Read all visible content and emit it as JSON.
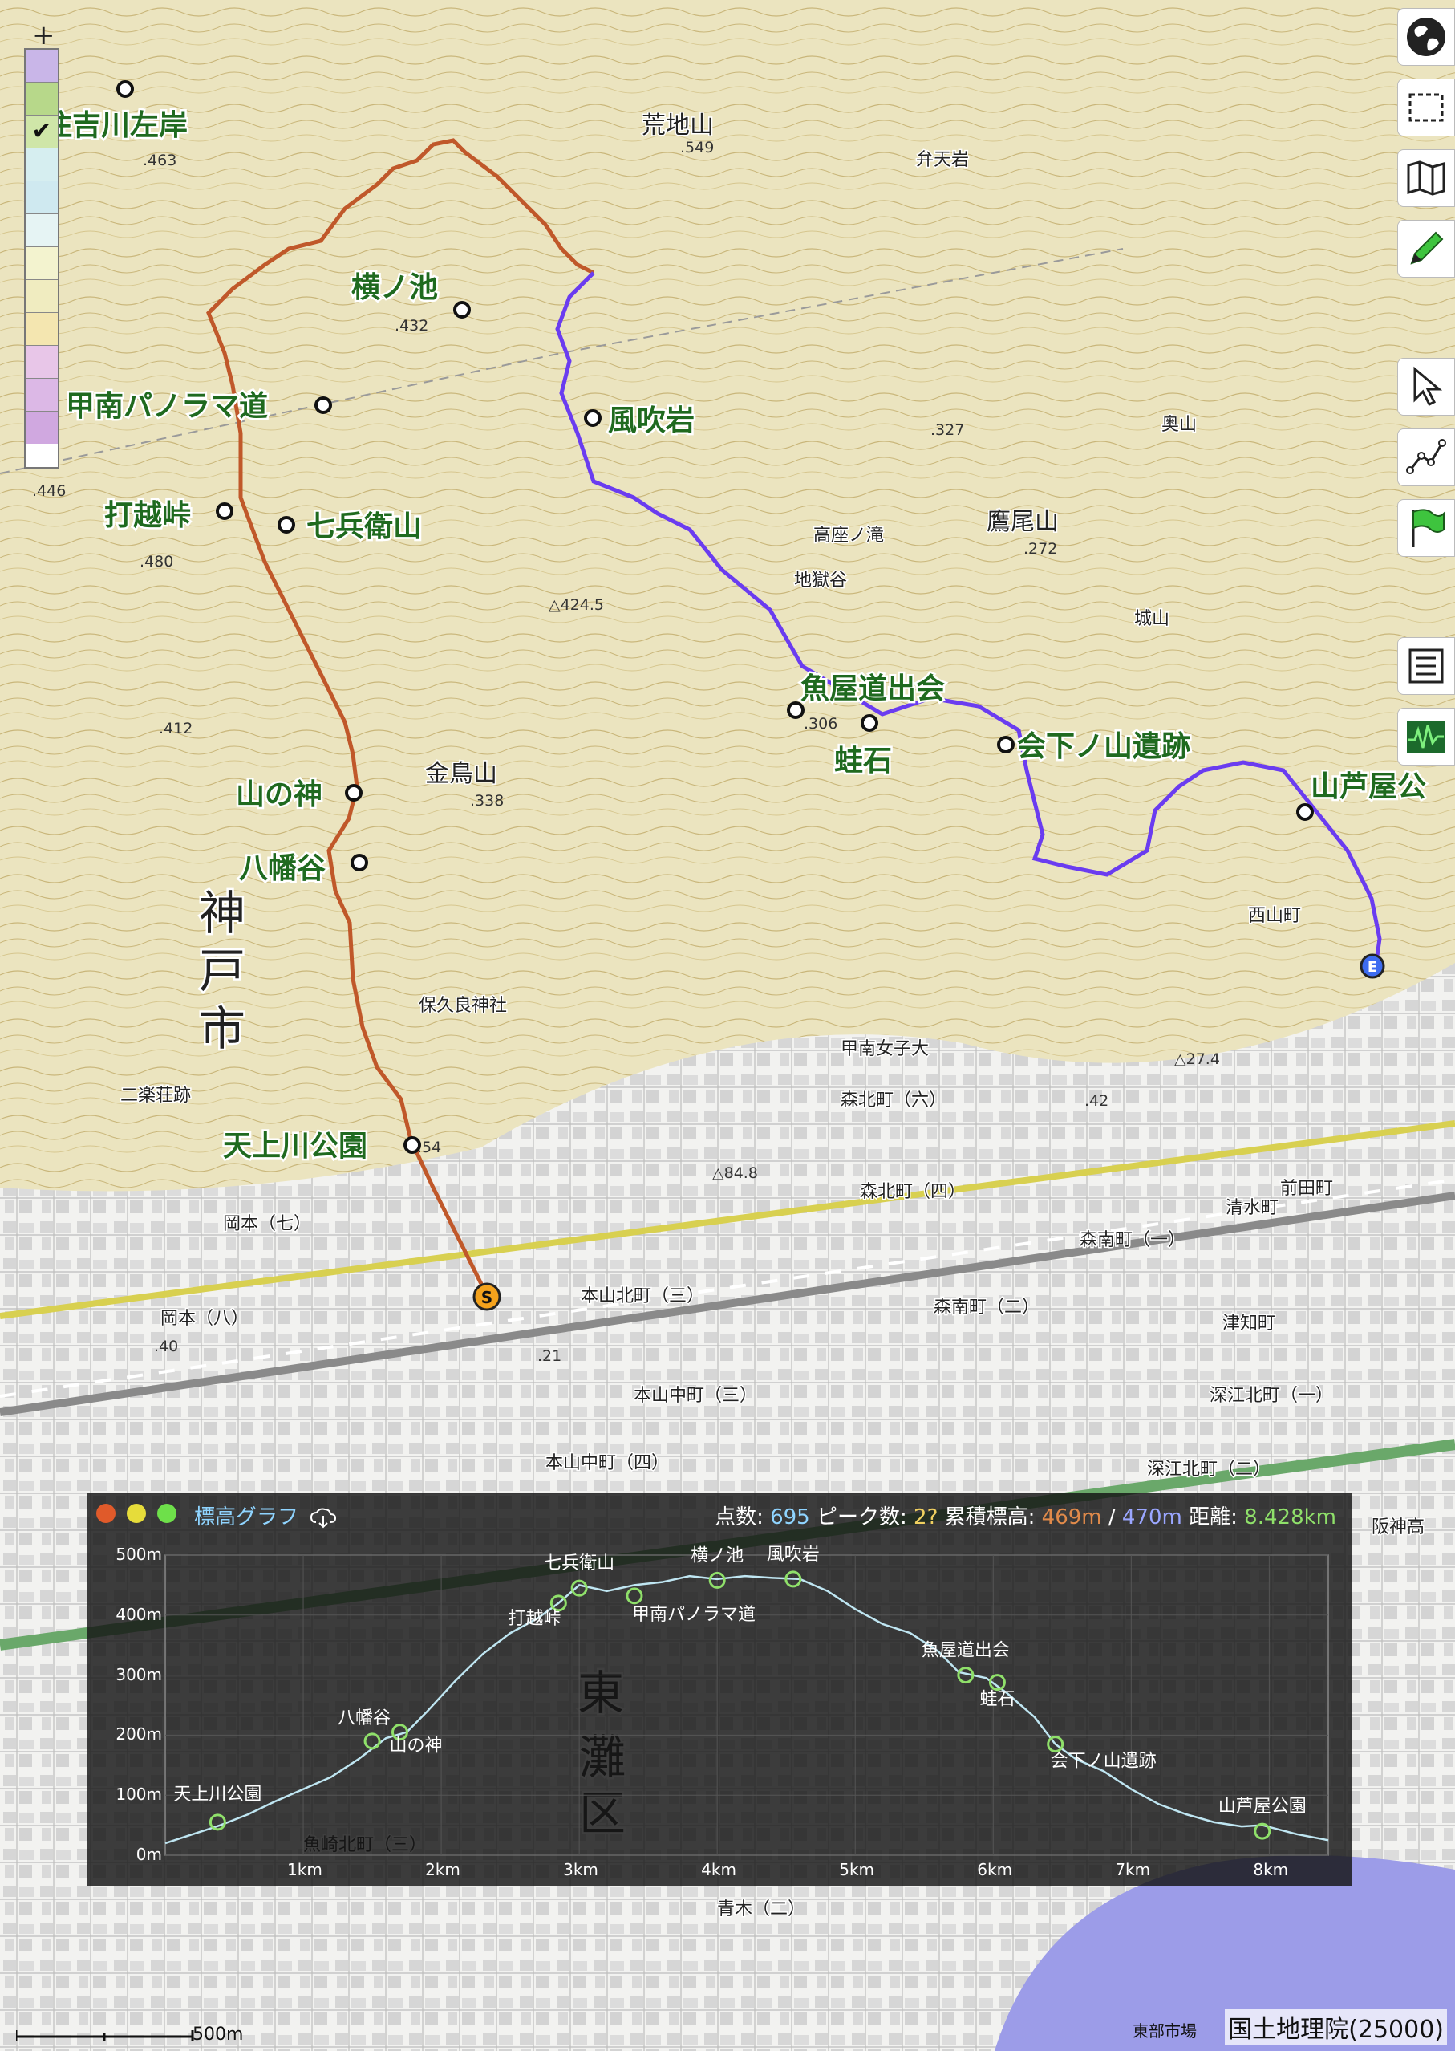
{
  "map": {
    "place_labels": [
      {
        "text": "住吉川左岸",
        "cls": "wp"
      },
      {
        "text": "荒地山",
        "cls": "mtn"
      },
      {
        "text": "弁天岩",
        "cls": "small"
      },
      {
        "text": "横ノ池",
        "cls": "wp"
      },
      {
        "text": "甲南パノラマ道",
        "cls": "wp"
      },
      {
        "text": "風吹岩",
        "cls": "wp"
      },
      {
        "text": "打越峠",
        "cls": "wp"
      },
      {
        "text": "七兵衛山",
        "cls": "wp"
      },
      {
        "text": "奥山",
        "cls": "small"
      },
      {
        "text": "鷹尾山",
        "cls": "mtn"
      },
      {
        "text": "高座ノ滝",
        "cls": "small"
      },
      {
        "text": "地獄谷",
        "cls": "small"
      },
      {
        "text": "城山",
        "cls": "small"
      },
      {
        "text": "魚屋道出会",
        "cls": "wp"
      },
      {
        "text": "蛙石",
        "cls": "wp"
      },
      {
        "text": "会下ノ山遺跡",
        "cls": "wp"
      },
      {
        "text": "山芦屋公",
        "cls": "wp"
      },
      {
        "text": "金鳥山",
        "cls": "mtn"
      },
      {
        "text": "山の神",
        "cls": "wp"
      },
      {
        "text": "八幡谷",
        "cls": "wp"
      },
      {
        "text": "神",
        "cls": "city"
      },
      {
        "text": "戸",
        "cls": "city"
      },
      {
        "text": "市",
        "cls": "city"
      },
      {
        "text": "保久良神社",
        "cls": "small"
      },
      {
        "text": "二楽荘跡",
        "cls": "small"
      },
      {
        "text": "天上川公園",
        "cls": "wp"
      },
      {
        "text": "甲南女子大",
        "cls": "small"
      },
      {
        "text": "森北町（六）",
        "cls": "small"
      },
      {
        "text": "森北町（四）",
        "cls": "small"
      },
      {
        "text": "岡本（七）",
        "cls": "small"
      },
      {
        "text": "本山北町（三）",
        "cls": "small"
      },
      {
        "text": "森南町（二）",
        "cls": "small"
      },
      {
        "text": "森南町（一）",
        "cls": "small"
      },
      {
        "text": "清水町",
        "cls": "small"
      },
      {
        "text": "前田町",
        "cls": "small"
      },
      {
        "text": "津知町",
        "cls": "small"
      },
      {
        "text": "本山中町（三）",
        "cls": "small"
      },
      {
        "text": "深江北町（一）",
        "cls": "small"
      },
      {
        "text": "本山中町（四）",
        "cls": "small"
      },
      {
        "text": "深江北町（二）",
        "cls": "small"
      },
      {
        "text": "岡本（八）",
        "cls": "small"
      },
      {
        "text": "西山町",
        "cls": "small"
      },
      {
        "text": "魚崎北町（三）",
        "cls": "small"
      },
      {
        "text": "青木（二）",
        "cls": "small"
      },
      {
        "text": "東",
        "cls": "ward"
      },
      {
        "text": "灘",
        "cls": "ward"
      },
      {
        "text": "区",
        "cls": "ward"
      },
      {
        "text": "阪神高",
        "cls": "small"
      }
    ],
    "elevations": [
      ".463",
      ".549",
      ".432",
      ".327",
      ".272",
      ".480",
      ".412",
      ".338",
      "△424.5",
      ".306",
      ".54",
      "△84.8",
      "△27.4",
      ".42",
      ".21",
      ".40",
      ".446"
    ],
    "markers": {
      "start": "S",
      "end": "E"
    },
    "scale_label": "500m",
    "credit": "国土地理院(25000)",
    "credit_small": "東部市場"
  },
  "toolbar": {
    "icons": [
      "globe-icon",
      "select-rectangle-icon",
      "map-icon",
      "pencil-icon",
      "pointer-icon",
      "polyline-icon",
      "flag-icon",
      "list-icon",
      "elevation-graph-icon"
    ]
  },
  "legend": {
    "zoom_label": "+"
  },
  "colors": {
    "route_ascent": "#c0582a",
    "route_descent": "#6a3cf0",
    "waypoint_label": "#1f6a1f",
    "graph_bg": "#141414",
    "graph_line": "#bfe6f2",
    "graph_marker": "#8fe06a",
    "stat_ascent": "#e08a4a",
    "stat_descent": "#9aa6ff",
    "stat_distance": "#8fe06a",
    "stat_points": "#8fd4ff",
    "stat_peaks": "#f0d060"
  },
  "elevation_graph": {
    "title": "標高グラフ",
    "stats": {
      "points_label": "点数:",
      "points_value": "695",
      "peaks_label": "ピーク数:",
      "peaks_value": "2?",
      "gain_label": "累積標高:",
      "gain_up": "469m",
      "slash": "/",
      "gain_down": "470m",
      "distance_label": "距離:",
      "distance_value": "8.428km"
    }
  },
  "chart_data": {
    "type": "line",
    "title": "標高グラフ",
    "xlabel": "",
    "ylabel": "",
    "xlim": [
      0,
      8.428
    ],
    "ylim": [
      0,
      500
    ],
    "y_ticks": [
      "0m",
      "100m",
      "200m",
      "300m",
      "400m",
      "500m"
    ],
    "x_ticks": [
      "1km",
      "2km",
      "3km",
      "4km",
      "5km",
      "6km",
      "7km",
      "8km"
    ],
    "grid": true,
    "series": [
      {
        "x": [
          0,
          0.2,
          0.4,
          0.6,
          0.8,
          1.0,
          1.2,
          1.4,
          1.6,
          1.75,
          1.9,
          2.1,
          2.3,
          2.5,
          2.7,
          2.85,
          3.0,
          3.2,
          3.4,
          3.6,
          3.8,
          4.0,
          4.2,
          4.4,
          4.6,
          4.8,
          5.0,
          5.2,
          5.4,
          5.6,
          5.75,
          5.95,
          6.1,
          6.3,
          6.45,
          6.6,
          6.8,
          7.0,
          7.2,
          7.4,
          7.6,
          7.8,
          7.95,
          8.2,
          8.428
        ],
        "y": [
          20,
          35,
          50,
          68,
          90,
          110,
          130,
          160,
          195,
          205,
          240,
          290,
          335,
          370,
          395,
          420,
          450,
          440,
          450,
          455,
          465,
          460,
          465,
          462,
          460,
          440,
          410,
          385,
          370,
          340,
          305,
          295,
          270,
          230,
          185,
          160,
          140,
          110,
          85,
          68,
          55,
          48,
          50,
          35,
          25
        ]
      }
    ],
    "markers": [
      {
        "label": "天上川公園",
        "x": 0.38,
        "y": 55
      },
      {
        "label": "八幡谷",
        "x": 1.5,
        "y": 190
      },
      {
        "label": "山の神",
        "x": 1.7,
        "y": 205
      },
      {
        "label": "打越峠",
        "x": 2.85,
        "y": 420
      },
      {
        "label": "七兵衛山",
        "x": 3.0,
        "y": 445
      },
      {
        "label": "甲南パノラマ道",
        "x": 3.4,
        "y": 432
      },
      {
        "label": "横ノ池",
        "x": 4.0,
        "y": 458
      },
      {
        "label": "風吹岩",
        "x": 4.55,
        "y": 460
      },
      {
        "label": "魚屋道出会",
        "x": 5.8,
        "y": 300
      },
      {
        "label": "蛙石",
        "x": 6.03,
        "y": 288
      },
      {
        "label": "会下ノ山遺跡",
        "x": 6.45,
        "y": 185
      },
      {
        "label": "山芦屋公園",
        "x": 7.95,
        "y": 40
      }
    ]
  }
}
